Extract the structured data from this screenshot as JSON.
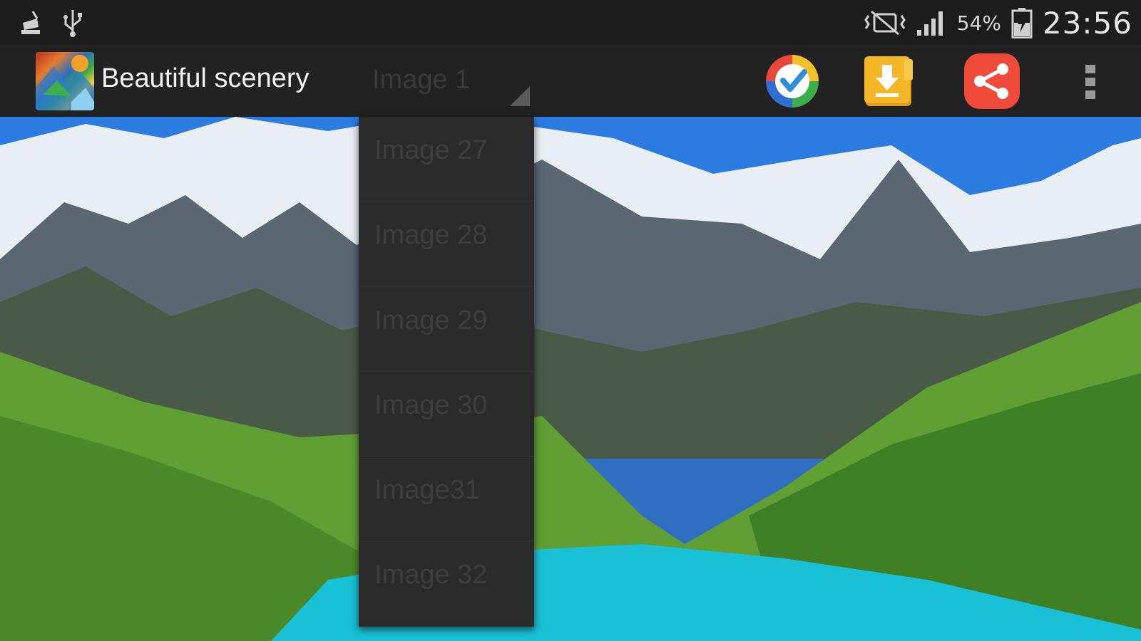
{
  "status_bar": {
    "battery_percent": "54%",
    "time": "23:56",
    "icons": [
      "cleaner-icon",
      "usb-icon",
      "mute-icon",
      "signal-icon",
      "battery-charging-icon"
    ]
  },
  "action_bar": {
    "title": "Beautiful scenery",
    "spinner_value": "Image 1",
    "actions": [
      "check-icon",
      "download-icon",
      "share-icon",
      "overflow-menu-icon"
    ],
    "colors": {
      "share": "#f04a3a",
      "download": "#f5b728",
      "background": "#222222"
    }
  },
  "dropdown": {
    "items": [
      "Image 27",
      "Image 28",
      "Image 29",
      "Image 30",
      "Image31",
      "Image 32"
    ]
  }
}
